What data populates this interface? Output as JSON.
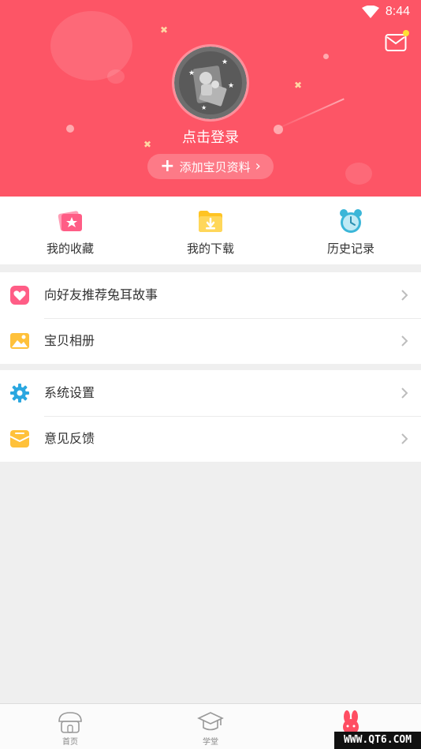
{
  "status_bar": {
    "time": "8:44",
    "wifi_icon": "wifi-icon"
  },
  "header": {
    "background": "#fd5566",
    "mail_icon": "mail-icon",
    "avatar_icon": "avatar-icon",
    "login_text": "点击登录",
    "add_profile_label": "添加宝贝资料"
  },
  "quick_actions": [
    {
      "label": "我的收藏",
      "icon": "favorites-icon"
    },
    {
      "label": "我的下载",
      "icon": "downloads-icon"
    },
    {
      "label": "历史记录",
      "icon": "history-icon"
    }
  ],
  "menu_groups": [
    [
      {
        "label": "向好友推荐兔耳故事",
        "icon": "heart-icon"
      },
      {
        "label": "宝贝相册",
        "icon": "album-icon"
      }
    ],
    [
      {
        "label": "系统设置",
        "icon": "settings-icon"
      },
      {
        "label": "意见反馈",
        "icon": "feedback-icon"
      }
    ]
  ],
  "tabs": [
    {
      "label": "首页",
      "icon": "home-icon"
    },
    {
      "label": "学堂",
      "icon": "school-icon"
    },
    {
      "label": "",
      "icon": "rabbit-icon",
      "active": true
    }
  ],
  "watermark": "WWW.QT6.COM"
}
